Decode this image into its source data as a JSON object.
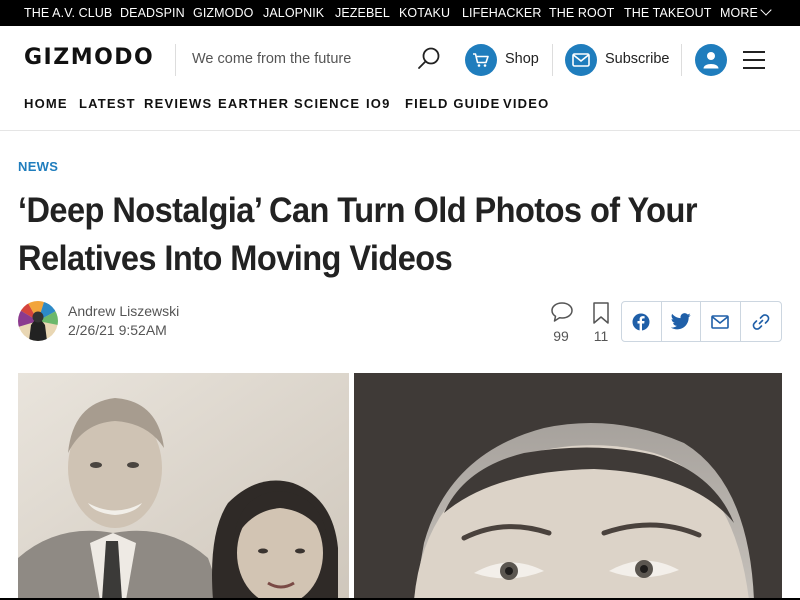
{
  "network_bar": {
    "links": [
      "THE A.V. CLUB",
      "DEADSPIN",
      "GIZMODO",
      "JALOPNIK",
      "JEZEBEL",
      "KOTAKU",
      "LIFEHACKER",
      "THE ROOT",
      "THE TAKEOUT"
    ],
    "more_label": "MORE"
  },
  "header": {
    "logo": "GIZMODO",
    "tagline": "We come from the future",
    "shop_label": "Shop",
    "subscribe_label": "Subscribe"
  },
  "section_nav": {
    "items": [
      "HOME",
      "LATEST",
      "REVIEWS",
      "EARTHER",
      "SCIENCE",
      "IO9",
      "FIELD GUIDE",
      "VIDEO"
    ]
  },
  "article": {
    "kicker": "NEWS",
    "headline_line1": "‘Deep Nostalgia’ Can Turn Old Photos of Your",
    "headline_line2": "Relatives Into Moving Videos",
    "author": "Andrew Liszewski",
    "date": "2/26/21 9:52AM",
    "comment_count": "99",
    "save_count": "11"
  },
  "icons": {
    "search": "search-icon",
    "shop": "cart-icon",
    "subscribe": "mail-icon",
    "account": "user-icon",
    "menu": "hamburger-icon",
    "comments": "comment-icon",
    "save": "bookmark-icon",
    "share": [
      "facebook-icon",
      "twitter-icon",
      "email-icon",
      "link-icon"
    ]
  },
  "colors": {
    "accent": "#1f7dbd",
    "network_bar": "#000000",
    "text": "#222222"
  }
}
